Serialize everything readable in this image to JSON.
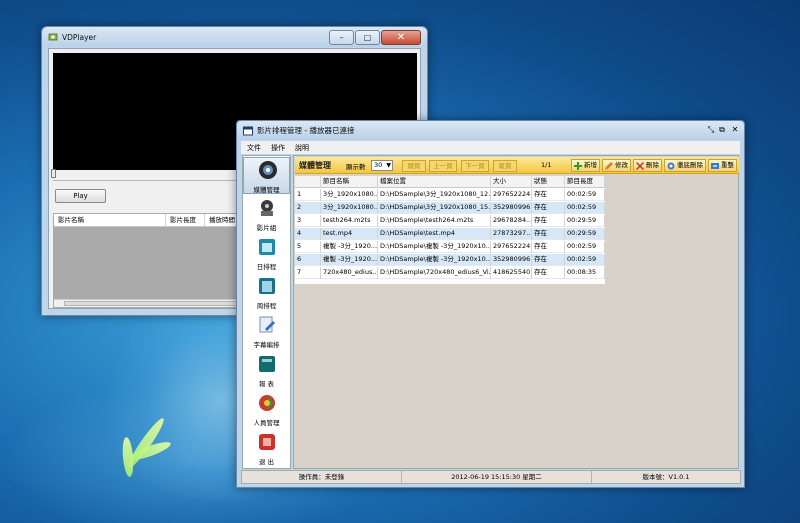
{
  "vdplayer": {
    "title": "VDPlayer",
    "close_glyph": "✕",
    "min_glyph": "–",
    "max_glyph": "□",
    "play_label": "Play",
    "list_columns": [
      "影片名稱",
      "影片長度",
      "播放時間"
    ]
  },
  "mainwin": {
    "title": "影片排程管理 - 播放器已連接",
    "controls": [
      "⤡",
      "⧉",
      "✕"
    ],
    "menu": [
      "文件",
      "操作",
      "說明"
    ],
    "nav": [
      {
        "label": "媒體管理",
        "icon": "media-disc-icon"
      },
      {
        "label": "影片組",
        "icon": "film-group-icon"
      },
      {
        "label": "日排程",
        "icon": "day-schedule-icon"
      },
      {
        "label": "周排程",
        "icon": "week-schedule-icon"
      },
      {
        "label": "字幕編排",
        "icon": "subtitle-icon"
      },
      {
        "label": "報 表",
        "icon": "report-icon"
      },
      {
        "label": "人員管理",
        "icon": "user-management-icon"
      },
      {
        "label": "退 出",
        "icon": "exit-icon"
      }
    ],
    "toolbar": {
      "title": "媒體管理",
      "page_size_label": "顯示數",
      "page_size_value": "30",
      "first_page": "頭頁",
      "prev_page": "上一頁",
      "next_page": "下一頁",
      "last_page": "尾頁",
      "page_info": "1/1",
      "add": "新增",
      "edit": "修改",
      "delete": "刪除",
      "purge": "徹底刪除",
      "reset": "重整"
    },
    "grid": {
      "columns": [
        "",
        "節目名稱",
        "檔案位置",
        "大小",
        "狀態",
        "節目長度"
      ],
      "rows": [
        [
          "1",
          "3分_1920x1080...",
          "D:\\HDSample\\3分_1920x1080_12...",
          "297652224",
          "存在",
          "00:02:59"
        ],
        [
          "2",
          "3分_1920x1080...",
          "D:\\HDSample\\3分_1920x1080_15...",
          "352980996",
          "存在",
          "00:02:59"
        ],
        [
          "3",
          "testh264.m2ts",
          "D:\\HDSample\\testh264.m2ts",
          "29678284...",
          "存在",
          "00:29:59"
        ],
        [
          "4",
          "test.mp4",
          "D:\\HDSample\\test.mp4",
          "27873297...",
          "存在",
          "00:29:59"
        ],
        [
          "5",
          "複製 -3分_1920...",
          "D:\\HDSample\\複製 -3分_1920x10...",
          "297652224",
          "存在",
          "00:02:59"
        ],
        [
          "6",
          "複製 -3分_1920...",
          "D:\\HDSample\\複製 -3分_1920x10...",
          "352980996",
          "存在",
          "00:02:59"
        ],
        [
          "7",
          "720x480_edius...",
          "D:\\HDSample\\720x480_edius6_Vi...",
          "418625540",
          "存在",
          "00:08:35"
        ]
      ]
    },
    "status": {
      "operator": "操作員：未登錄",
      "datetime": "2012-06-19 15:15:30 星期二",
      "version": "版本號：V1.0.1"
    }
  }
}
